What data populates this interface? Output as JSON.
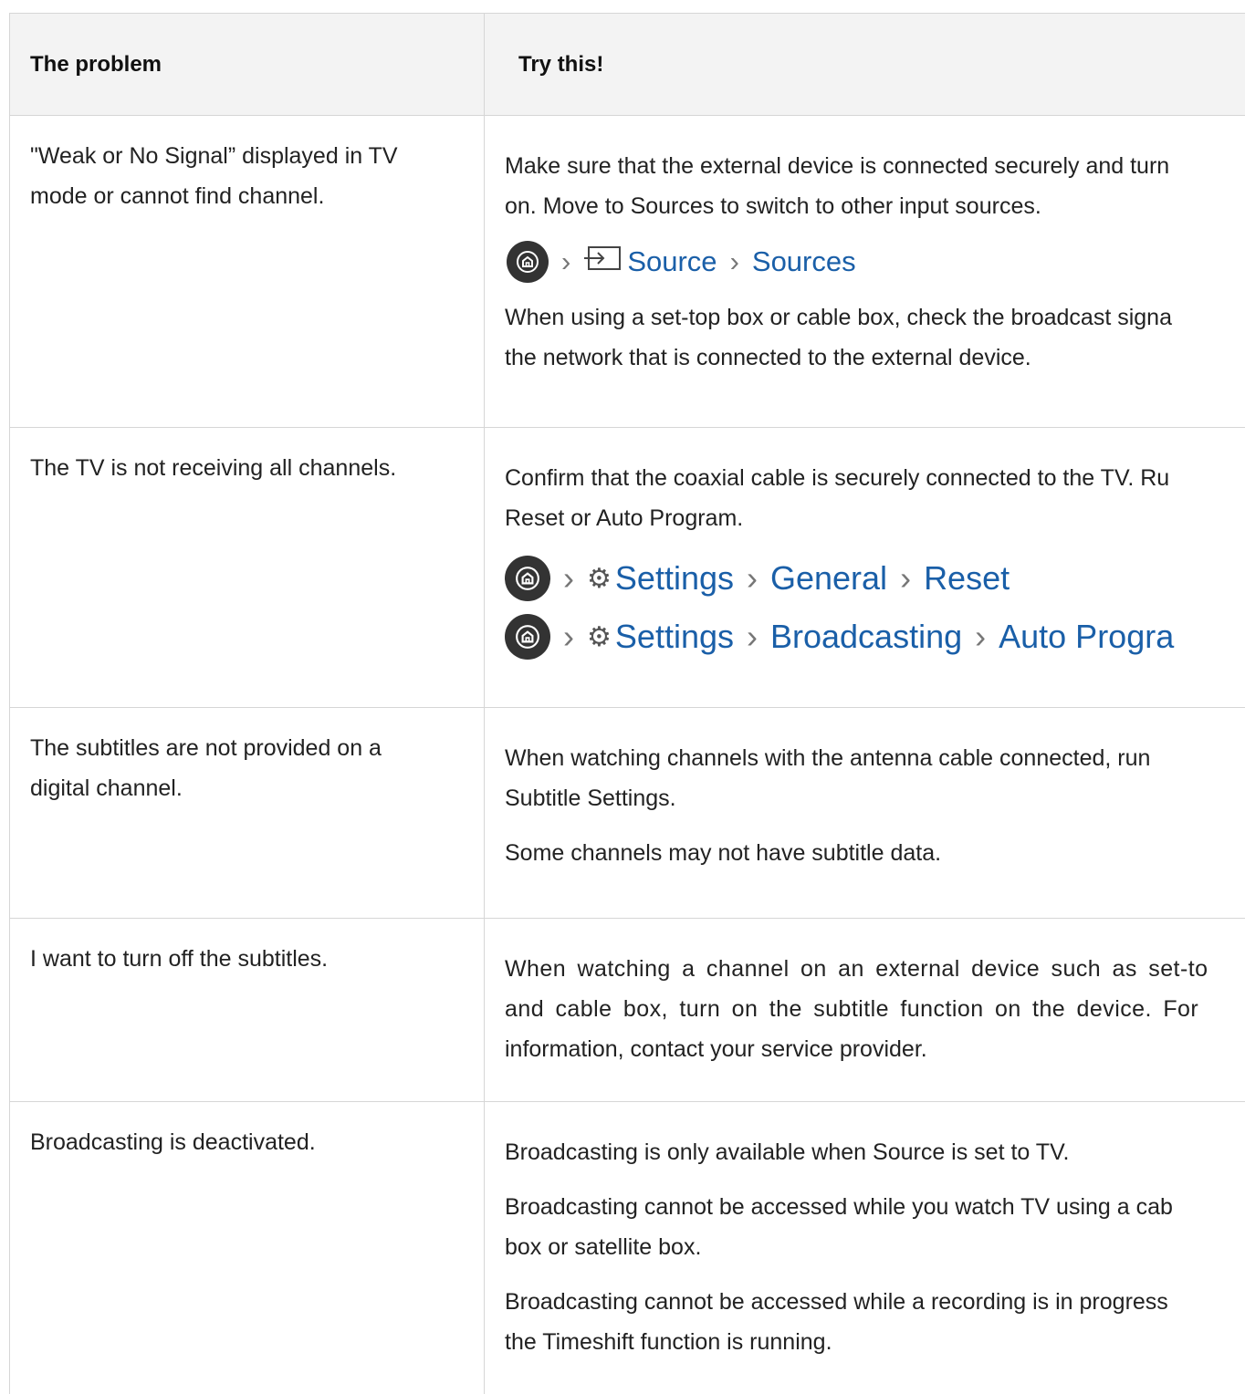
{
  "table": {
    "header": {
      "problem": "The problem",
      "solution": "Try this!"
    },
    "rows": [
      {
        "problem_lines": [
          "\"Weak or No Signal” displayed in TV",
          "mode or cannot find channel."
        ],
        "para1_lines": [
          "Make sure that the external device is connected securely and turn",
          "on. Move to Sources to switch to other input sources."
        ],
        "path1": {
          "icon1": "home-icon",
          "step1": "Source",
          "step2": "Sources"
        },
        "para2_lines": [
          "When using a set-top box or cable box, check the broadcast signa",
          "the network that is connected to the external device."
        ]
      },
      {
        "problem_lines": [
          "The TV is not receiving all channels."
        ],
        "para1_lines": [
          "Confirm that the coaxial cable is securely connected to the TV. Ru",
          "Reset or Auto Program."
        ],
        "path_a": {
          "settings": "Settings",
          "general": "General",
          "reset": "Reset"
        },
        "path_b": {
          "settings": "Settings",
          "broadcasting": "Broadcasting",
          "auto": "Auto Progra"
        }
      },
      {
        "problem_lines": [
          "The subtitles are not provided on a",
          "digital channel."
        ],
        "para1_lines": [
          "When watching channels with the antenna cable connected, run",
          "Subtitle Settings."
        ],
        "para2_lines": [
          "Some channels may not have subtitle data."
        ]
      },
      {
        "problem_lines": [
          "I want to turn off the subtitles."
        ],
        "para1_lines": [
          "When watching a channel on an external device such as set-to",
          "and cable box, turn on the subtitle function on the device. For",
          "information, contact your service provider."
        ]
      },
      {
        "problem_lines": [
          "Broadcasting is deactivated."
        ],
        "para1_lines": [
          "Broadcasting is only available when Source is set to TV."
        ],
        "para2_lines": [
          "Broadcasting cannot be accessed while you watch TV using a cab",
          "box or satellite box."
        ],
        "para3_lines": [
          "Broadcasting cannot be accessed while a recording is in progress",
          "the Timeshift function is running."
        ]
      }
    ]
  }
}
